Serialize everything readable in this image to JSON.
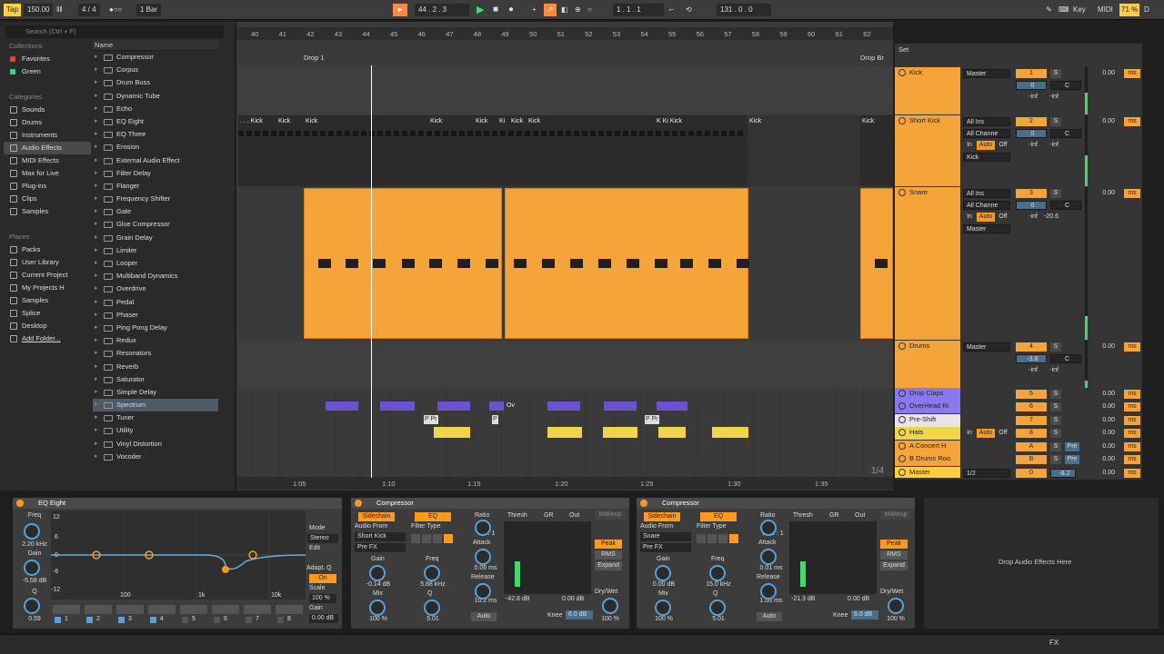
{
  "topbar": {
    "tap": "Tap",
    "tempo": "150.00",
    "sig": "4 / 4",
    "bar": "1 Bar",
    "pos": "44 .  2 .  3",
    "loop_start": "1 .  1 .  1",
    "loop_len": "131 .  0 .  0",
    "key": "Key",
    "midi": "MIDI",
    "cpu": "71 %",
    "d": "D"
  },
  "browser": {
    "search_placeholder": "Search (Ctrl + F)",
    "collections_title": "Collections",
    "collections": [
      {
        "label": "Favorites",
        "color": "#e0403a"
      },
      {
        "label": "Green",
        "color": "#3ed67c"
      }
    ],
    "categories_title": "Categories",
    "categories": [
      "Sounds",
      "Drums",
      "Instruments",
      "Audio Effects",
      "MIDI Effects",
      "Max for Live",
      "Plug-ins",
      "Clips",
      "Samples"
    ],
    "places_title": "Places",
    "places": [
      "Packs",
      "User Library",
      "Current Project",
      "My Projects H",
      "Samples",
      "Splice",
      "Desktop",
      "Add Folder..."
    ],
    "name_header": "Name",
    "devices": [
      "Compressor",
      "Corpus",
      "Drum Buss",
      "Dynamic Tube",
      "Echo",
      "EQ Eight",
      "EQ Three",
      "Erosion",
      "External Audio Effect",
      "Filter Delay",
      "Flanger",
      "Frequency Shifter",
      "Gate",
      "Glue Compressor",
      "Grain Delay",
      "Limiter",
      "Looper",
      "Multiband Dynamics",
      "Overdrive",
      "Pedal",
      "Phaser",
      "Ping Pong Delay",
      "Redux",
      "Resonators",
      "Reverb",
      "Saturator",
      "Simple Delay",
      "Spectrum",
      "Tuner",
      "Utility",
      "Vinyl Distortion",
      "Vocoder"
    ]
  },
  "arrangement": {
    "bars": [
      "40",
      "41",
      "42",
      "43",
      "44",
      "45",
      "46",
      "47",
      "48",
      "49",
      "50",
      "51",
      "52",
      "53",
      "54",
      "55",
      "56",
      "57",
      "58",
      "59",
      "60",
      "61",
      "62"
    ],
    "locator1": "Drop 1",
    "locator2": "Drop Br",
    "kick_clips": [
      ". . . Kick",
      "Kick",
      "Kick",
      "Kick",
      "Kick",
      "Ki",
      "Kick",
      "Kick",
      "K Ki Kick",
      "Kick",
      "Kick"
    ],
    "times": [
      "1:05",
      "1:10",
      "1:15",
      "1:20",
      "1:25",
      "1:30",
      "1:35"
    ],
    "page": "1/4",
    "pre_shift_clips": [
      "P Pr",
      "P",
      "P Pr"
    ],
    "ov_label": "Ov"
  },
  "mixer": {
    "set_label": "Set",
    "tracks": [
      {
        "name": "Kick",
        "route": "Master",
        "num": "1",
        "vol": "0.00",
        "pan": "0",
        "panC": "C",
        "inf1": "-inf",
        "inf2": "-inf",
        "color": "#f5a43a"
      },
      {
        "name": "Short Kick",
        "route": "All Ins",
        "route2": "All Channe",
        "sub": "Kick",
        "num": "2",
        "vol": "0.00",
        "pan": "0",
        "panC": "C",
        "inf1": "-inf",
        "inf2": "-inf",
        "color": "#f5a43a"
      },
      {
        "name": "Snare",
        "route": "All Ins",
        "route2": "All Channe",
        "sub": "Master",
        "num": "3",
        "vol": "0.00",
        "pan": "0",
        "panC": "C",
        "inf1": "-inf",
        "inf2": "-20.6",
        "color": "#f5a43a"
      },
      {
        "name": "Drums",
        "route": "Master",
        "num": "4",
        "vol": "0.00",
        "pan": "-3.8",
        "panC": "C",
        "inf1": "-inf",
        "inf2": "-inf",
        "color": "#f5a43a"
      },
      {
        "name": "Drop Claps",
        "num": "5",
        "vol": "0.00",
        "color": "#8a78f0"
      },
      {
        "name": "OverHead Ri",
        "num": "6",
        "vol": "0.00",
        "color": "#8a78f0"
      },
      {
        "name": "Pre-Shift",
        "num": "7",
        "vol": "0.00",
        "color": "#e8e4ea"
      },
      {
        "name": "Hats",
        "num": "8",
        "vol": "0.00",
        "color": "#f1d548"
      },
      {
        "name": "A Concert H",
        "num": "A",
        "vol": "0.00",
        "color": "#f5a43a"
      },
      {
        "name": "B Drums Roo",
        "num": "B",
        "vol": "0.00",
        "color": "#f5a43a"
      },
      {
        "name": "Master",
        "route": "1/2",
        "num": "0",
        "vol": "0.00",
        "pan2": "-8.2",
        "color": "#ffcf40"
      }
    ],
    "in": "In",
    "auto": "Auto",
    "off": "Off",
    "s": "S",
    "pre": "Pre",
    "ms": "ms"
  },
  "devices": {
    "eq": {
      "title": "EQ Eight",
      "freq_lbl": "Freq",
      "freq": "2.20 kHz",
      "gain_lbl": "Gain",
      "gain": "-5.58 dB",
      "q_lbl": "Q",
      "q": "0.59",
      "mode_lbl": "Mode",
      "mode": "Stereo",
      "edit": "Edit",
      "adapt": "Adapt. Q",
      "on": "On",
      "scale_lbl": "Scale",
      "scale": "100 %",
      "gain2_lbl": "Gain",
      "gain2": "0.00 dB",
      "db": [
        "12",
        "6",
        "0",
        "-6",
        "-12"
      ],
      "hz": [
        "100",
        "1k",
        "10k"
      ],
      "bands": [
        "1",
        "2",
        "3",
        "4",
        "5",
        "6",
        "7",
        "8"
      ]
    },
    "comp1": {
      "title": "Compressor",
      "sidechain": "Sidechain",
      "eq": "EQ",
      "audio_from": "Audio From",
      "src": "Short Kick",
      "prefx": "Pre FX",
      "filter_type": "Filter Type",
      "gain_lbl": "Gain",
      "gain": "-0.14 dB",
      "freq_lbl": "Freq",
      "freq": "5.88 kHz",
      "mix_lbl": "Mix",
      "mix": "100 %",
      "q_lbl": "Q",
      "q": "5.01",
      "ratio_lbl": "Ratio",
      "ratio": "inf : 1",
      "attack_lbl": "Attack",
      "attack": "0.06 ms",
      "release_lbl": "Release",
      "release": "10.2 ms",
      "auto": "Auto",
      "thresh": "Thresh",
      "gr": "GR",
      "out": "Out",
      "thresh_val": "-42.8 dB",
      "out_val": "0.00 dB",
      "knee_lbl": "Knee",
      "knee": "6.0 dB",
      "makeup": "Makeup",
      "peak": "Peak",
      "rms": "RMS",
      "expand": "Expand",
      "drywet_lbl": "Dry/Wet",
      "drywet": "100 %"
    },
    "comp2": {
      "title": "Compressor",
      "sidechain": "Sidechain",
      "eq": "EQ",
      "audio_from": "Audio From",
      "src": "Snare",
      "prefx": "Pre FX",
      "filter_type": "Filter Type",
      "gain_lbl": "Gain",
      "gain": "0.00 dB",
      "freq_lbl": "Freq",
      "freq": "15.0 kHz",
      "mix_lbl": "Mix",
      "mix": "100 %",
      "q_lbl": "Q",
      "q": "5.01",
      "ratio_lbl": "Ratio",
      "ratio": "5.25 : 1",
      "attack_lbl": "Attack",
      "attack": "0.01 ms",
      "release_lbl": "Release",
      "release": "1.00 ms",
      "auto": "Auto",
      "thresh": "Thresh",
      "gr": "GR",
      "out": "Out",
      "thresh_val": "-21.3 dB",
      "out_val": "0.00 dB",
      "knee_lbl": "Knee",
      "knee": "6.0 dB",
      "makeup": "Makeup",
      "peak": "Peak",
      "rms": "RMS",
      "expand": "Expand",
      "drywet_lbl": "Dry/Wet",
      "drywet": "100 %"
    },
    "drop_hint": "Drop Audio Effects Here"
  },
  "status": {
    "fx": "FX"
  },
  "colors": {
    "accent": "#ff9a1f",
    "clip_orange": "#f5a43a",
    "hats": "#f1d548",
    "claps": "#6953d1"
  }
}
